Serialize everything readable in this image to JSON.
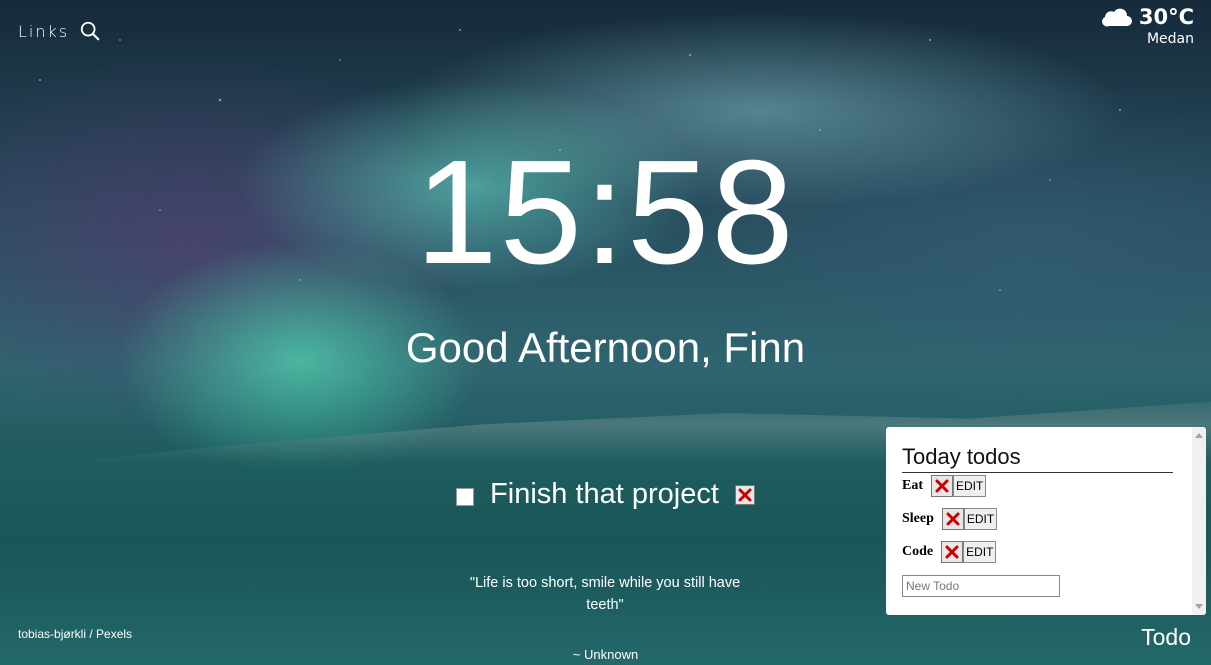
{
  "header": {
    "links_label": "Links"
  },
  "weather": {
    "temperature": "30°C",
    "city": "Medan",
    "icon": "cloud-icon"
  },
  "clock": {
    "time": "15:58"
  },
  "greeting": "Good Afternoon, Finn",
  "focus": {
    "text": "Finish that project",
    "checked": false
  },
  "quote": {
    "text": "\"Life is too short, smile while you still have teeth\"",
    "author": "~ Unknown"
  },
  "photo_credit": "tobias-bjørkli / Pexels",
  "todo_toggle_label": "Todo",
  "todo_panel": {
    "title": "Today todos",
    "items": [
      {
        "label": "Eat",
        "edit_label": "EDIT"
      },
      {
        "label": "Sleep",
        "edit_label": "EDIT"
      },
      {
        "label": "Code",
        "edit_label": "EDIT"
      }
    ],
    "new_todo_placeholder": "New Todo"
  },
  "colors": {
    "text": "#ffffff",
    "panel_bg": "#ffffff",
    "delete_x": "#cc0000"
  }
}
